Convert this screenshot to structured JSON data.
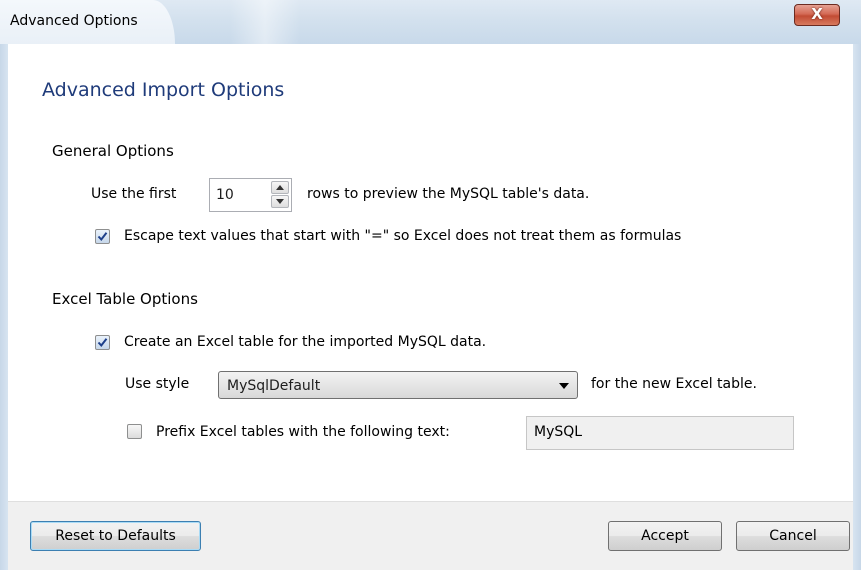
{
  "window": {
    "title": "Advanced Options",
    "close_glyph": "X"
  },
  "heading": "Advanced Import Options",
  "general": {
    "title": "General Options",
    "preview_prefix": "Use the first",
    "preview_rows": "10",
    "preview_suffix": "rows to preview the MySQL table's data.",
    "escape_label": "Escape text values that start with \"=\" so Excel does not treat them as formulas",
    "escape_checked": true
  },
  "excel_table": {
    "title": "Excel Table Options",
    "create_label": "Create an Excel table for the imported MySQL data.",
    "create_checked": true,
    "style_prefix": "Use style",
    "style_value": "MySqlDefault",
    "style_suffix": "for the new Excel table.",
    "prefix_label": "Prefix Excel tables with the following text:",
    "prefix_checked": false,
    "prefix_value": "MySQL"
  },
  "buttons": {
    "reset": "Reset to Defaults",
    "accept": "Accept",
    "cancel": "Cancel"
  },
  "colors": {
    "heading": "#1f3b7a",
    "close": "#c24b34",
    "frame": "#c8d9ea"
  },
  "icons": [
    "close-icon",
    "spin-up-icon",
    "spin-down-icon",
    "checkmark-icon",
    "dropdown-arrow-icon"
  ]
}
